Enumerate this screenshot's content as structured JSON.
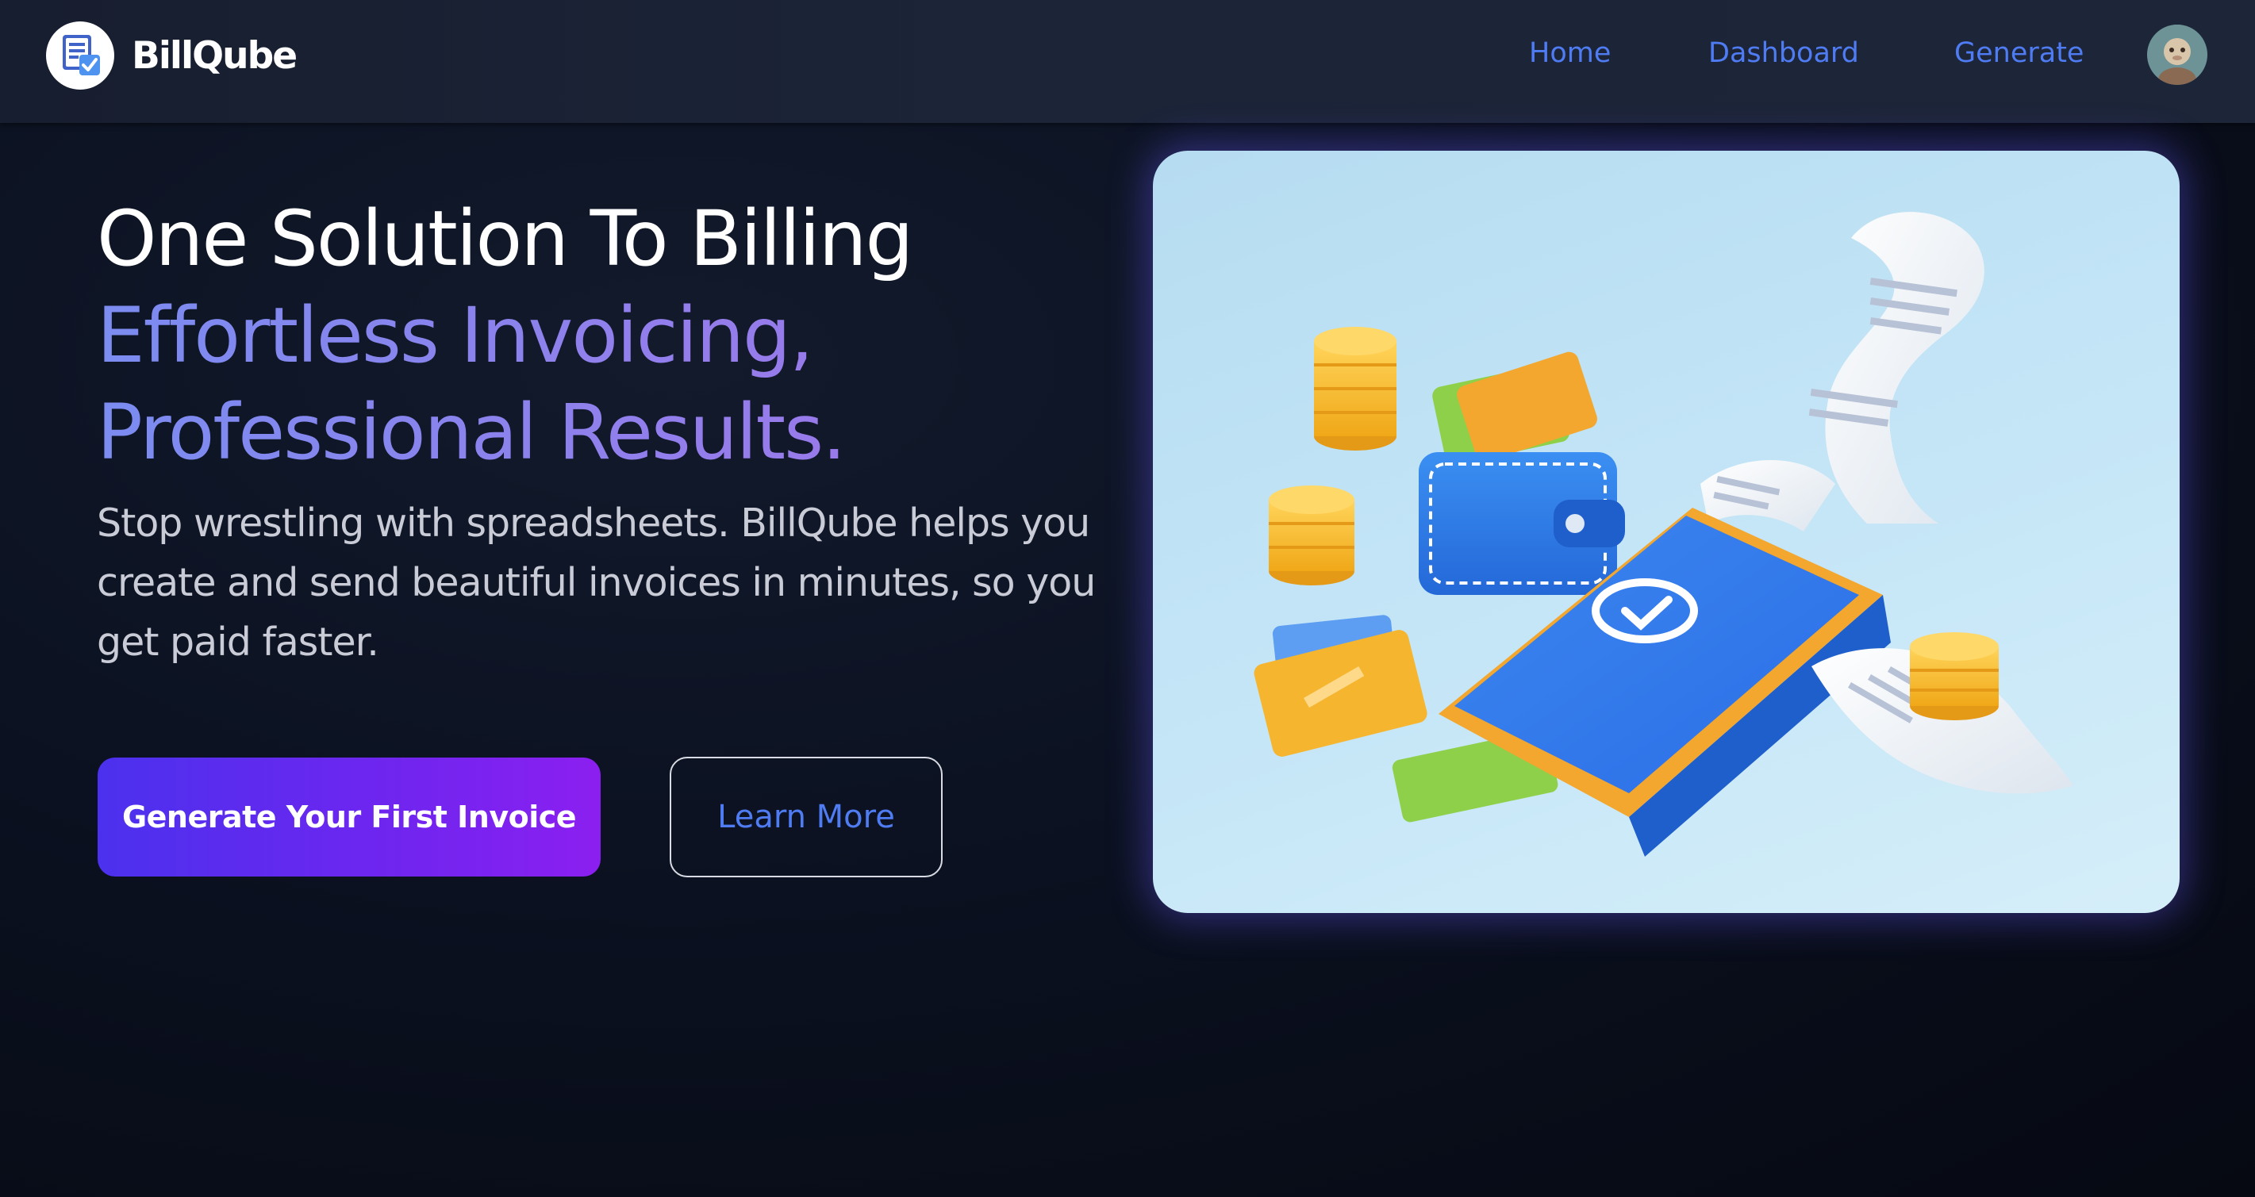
{
  "navbar": {
    "brand_name": "BillQube",
    "links": {
      "home": "Home",
      "dashboard": "Dashboard",
      "generate": "Generate"
    }
  },
  "hero": {
    "title_line1": "One Solution To Billing",
    "title_line2": "Effortless Invoicing,",
    "title_line3": "Professional Results.",
    "description": "Stop wrestling with spreadsheets. BillQube helps you create and send beautiful invoices in minutes, so you get paid faster.",
    "primary_button": "Generate Your First Invoice",
    "secondary_button": "Learn More"
  },
  "colors": {
    "accent_link": "#4f7cf2",
    "primary_gradient_start": "#4b31ee",
    "primary_gradient_end": "#8b1ff0",
    "title_accent": "#8f80ec",
    "background": "#0b1120"
  },
  "icons": {
    "logo": "invoice-check-logo-icon",
    "avatar": "user-avatar"
  }
}
